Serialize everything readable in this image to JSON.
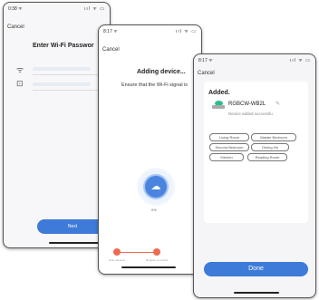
{
  "phone1": {
    "status_time": "0:38 ᯤ",
    "status_icons": "ııl ᯤ ▭",
    "cancel": "Cancel",
    "title": "Enter Wi-Fi Passwor",
    "wifi_icon": "wifi-icon",
    "lock_icon": "lock-icon",
    "next": "Next"
  },
  "phone2": {
    "status_time": "8:17 ᯤ",
    "status_icons": "ııl ᯤ ▭",
    "cancel": "Cancel",
    "title": "Adding device...",
    "ensure": "Ensure that the Wi-Fi signal is",
    "percent": "0%",
    "cloud_icon": "cloud-icon",
    "steps": [
      "Scan devices",
      "Register on Cloud"
    ]
  },
  "phone3": {
    "status_time": "8:17 ᯤ",
    "status_icons": "ııl ᯤ ▭",
    "cancel": "Cancel",
    "added": "Added.",
    "device_name": "RGBCW-WB2L",
    "success": "Device added successfu",
    "rooms": [
      "Living Room",
      "Master Bedroom",
      "Second Bedroom",
      "Dining Ha",
      "Kitchen",
      "Reading Room"
    ],
    "done": "Done",
    "accent": "#3e7ad8",
    "bulb_color": "#2dbd8d"
  }
}
